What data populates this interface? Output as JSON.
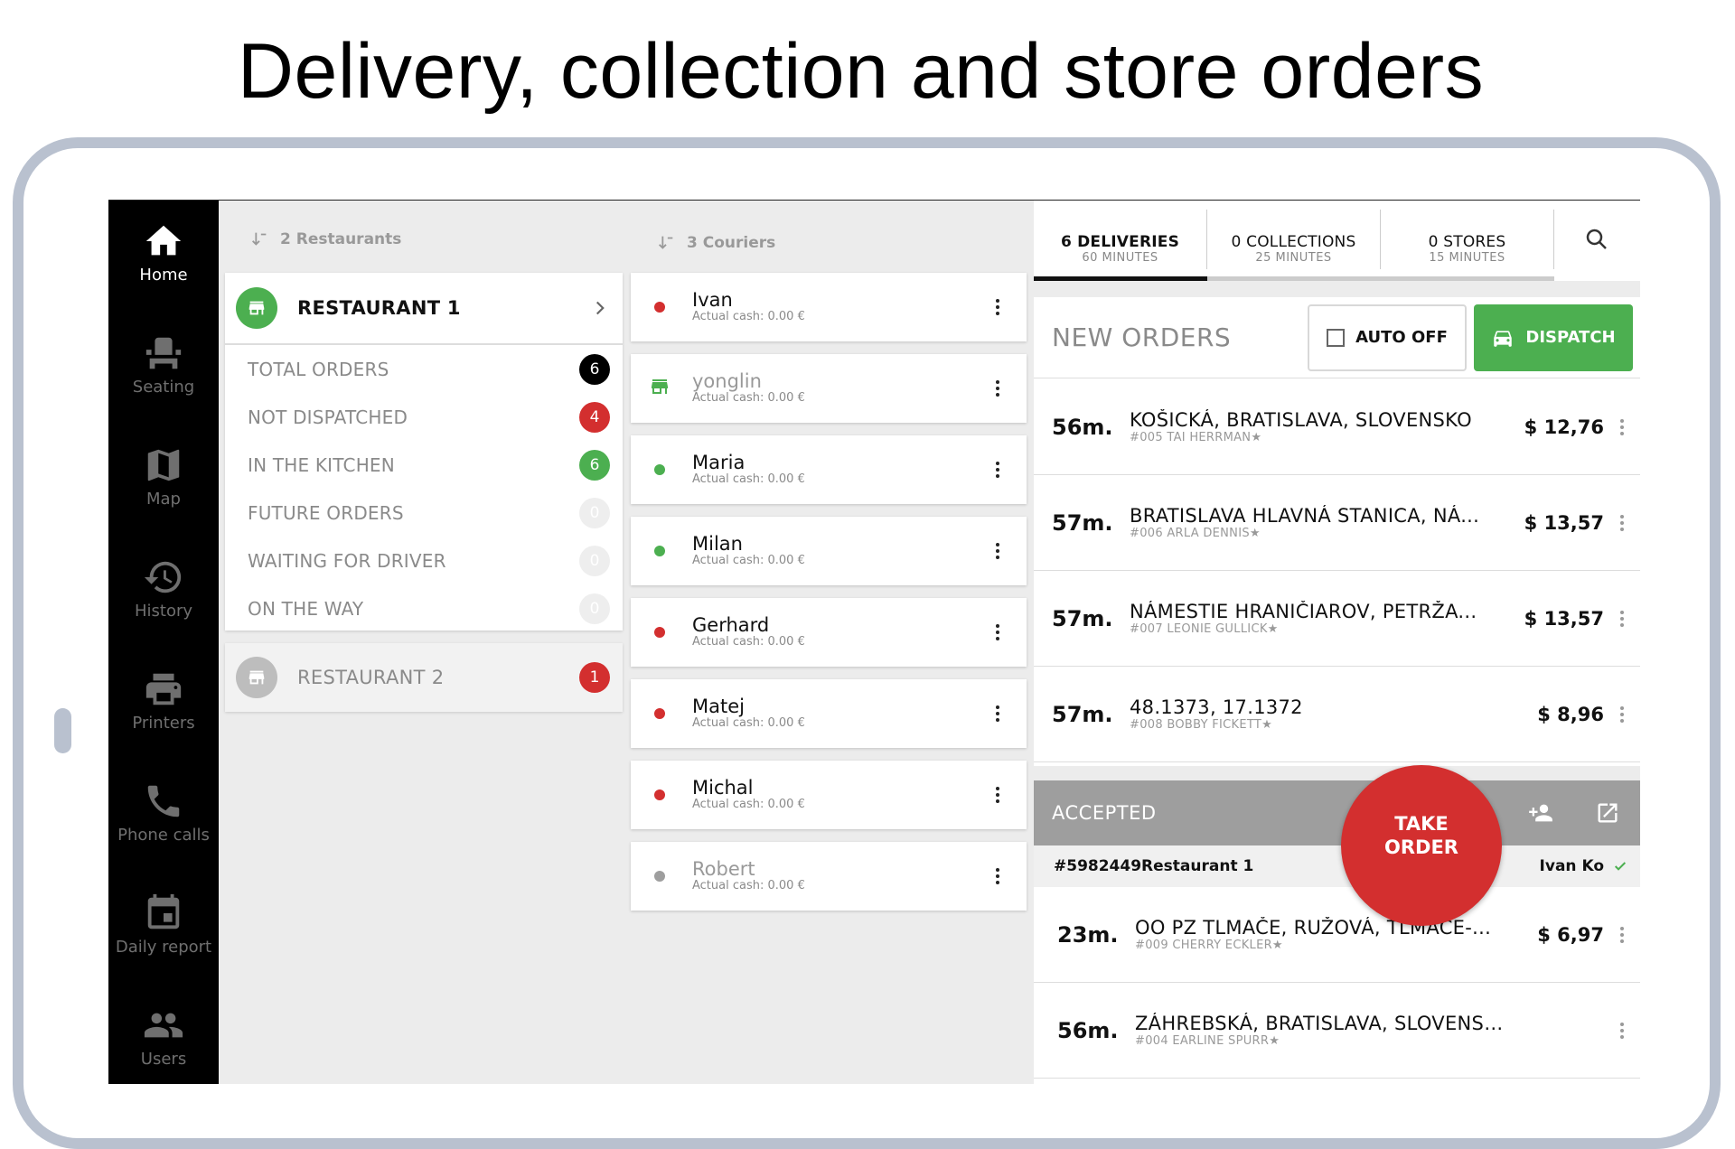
{
  "headline": "Delivery, collection and store orders",
  "nav": {
    "items": [
      {
        "label": "Home",
        "icon": "home-icon"
      },
      {
        "label": "Seating",
        "icon": "seat-icon"
      },
      {
        "label": "Map",
        "icon": "map-icon"
      },
      {
        "label": "History",
        "icon": "history-icon"
      },
      {
        "label": "Printers",
        "icon": "printer-icon"
      },
      {
        "label": "Phone calls",
        "icon": "phone-icon"
      },
      {
        "label": "Daily report",
        "icon": "calendar-icon"
      },
      {
        "label": "Users",
        "icon": "users-icon"
      }
    ]
  },
  "restaurants": {
    "header": "2 Restaurants",
    "r1": {
      "name": "RESTAURANT 1"
    },
    "stats": [
      {
        "label": "TOTAL ORDERS",
        "count": "6",
        "color": "#000000"
      },
      {
        "label": "NOT DISPATCHED",
        "count": "4",
        "color": "#d32f2f"
      },
      {
        "label": "IN THE KITCHEN",
        "count": "6",
        "color": "#4caf50"
      },
      {
        "label": "FUTURE ORDERS",
        "count": "0",
        "color": "#eeeeee"
      },
      {
        "label": "WAITING FOR DRIVER",
        "count": "0",
        "color": "#eeeeee"
      },
      {
        "label": "ON THE WAY",
        "count": "0",
        "color": "#eeeeee"
      }
    ],
    "r2": {
      "name": "RESTAURANT 2",
      "count": "1"
    }
  },
  "couriers": {
    "header": "3 Couriers",
    "list": [
      {
        "name": "Ivan",
        "cash": "Actual cash: 0.00 €",
        "status": "red"
      },
      {
        "name": "yonglin",
        "cash": "Actual cash: 0.00 €",
        "status": "store"
      },
      {
        "name": "Maria",
        "cash": "Actual cash: 0.00 €",
        "status": "green"
      },
      {
        "name": "Milan",
        "cash": "Actual cash: 0.00 €",
        "status": "green"
      },
      {
        "name": "Gerhard",
        "cash": "Actual cash: 0.00 €",
        "status": "red"
      },
      {
        "name": "Matej",
        "cash": "Actual cash: 0.00 €",
        "status": "red"
      },
      {
        "name": "Michal",
        "cash": "Actual cash: 0.00 €",
        "status": "red"
      },
      {
        "name": "Robert",
        "cash": "Actual cash: 0.00 €",
        "status": "gray"
      }
    ]
  },
  "tabs": [
    {
      "main": "6 DELIVERIES",
      "sub": "60 MINUTES"
    },
    {
      "main": "0 COLLECTIONS",
      "sub": "25 MINUTES"
    },
    {
      "main": "0 STORES",
      "sub": "15 MINUTES"
    }
  ],
  "new_orders": {
    "title": "NEW ORDERS",
    "auto_off": "AUTO OFF",
    "dispatch": "DISPATCH",
    "list": [
      {
        "time": "56m.",
        "address": "KOŠICKÁ, BRATISLAVA, SLOVENSKO",
        "sub": "#005  TAI HERRMAN★",
        "price": "$ 12,76"
      },
      {
        "time": "57m.",
        "address": "BRATISLAVA HLAVNÁ STANICA, NÁ...",
        "sub": "#006  ARLA DENNIS★",
        "price": "$ 13,57"
      },
      {
        "time": "57m.",
        "address": "NÁMESTIE HRANIČIAROV, PETRŽA...",
        "sub": "#007  LEONIE GULLICK★",
        "price": "$ 13,57"
      },
      {
        "time": "57m.",
        "address": "48.1373, 17.1372",
        "sub": "#008  BOBBY FICKETT★",
        "price": "$ 8,96"
      }
    ]
  },
  "accepted": {
    "title": "ACCEPTED",
    "order_id": "#5982449Restaurant 1",
    "driver": "Ivan Ko",
    "list": [
      {
        "time": "23m.",
        "address": "OO PZ TLMAČE, RUŽOVÁ, TLMAČE-...",
        "sub": "#009  CHERRY ECKLER★",
        "price": "$ 6,97"
      },
      {
        "time": "56m.",
        "address": "ZÁHREBSKÁ, BRATISLAVA, SLOVENSKO",
        "sub": "#004  EARLINE SPURR★",
        "price": ""
      }
    ]
  },
  "fab": {
    "line1": "TAKE",
    "line2": "ORDER"
  },
  "colors": {
    "green": "#4caf50",
    "red": "#d32f2f",
    "gray": "#9e9e9e",
    "accent": "#000000"
  }
}
